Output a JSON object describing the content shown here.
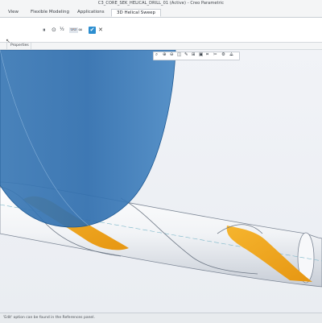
{
  "window": {
    "title": "C3_CORE_SEK_HELICAL_DRILL_01 (Active) - Creo Parametric"
  },
  "tabs": [
    {
      "label": "View"
    },
    {
      "label": "Flexible Modeling"
    },
    {
      "label": "Applications"
    },
    {
      "label": "3D Helical Sweep"
    }
  ],
  "ribbon": {
    "icons": [
      "pointer-arrow-icon",
      "pause-icon",
      "preview-icon",
      "verify-icon",
      "glasses-icon",
      "ok-icon",
      "cancel-icon"
    ],
    "pause_glyph": "⏸",
    "preview_glyph": "⊙",
    "verify_glyph": "½",
    "view_glyph": "∞",
    "ok_glyph": "✔",
    "cancel_glyph": "✕"
  },
  "subtabs": [
    {
      "label": "Properties"
    }
  ],
  "graphics_toolbar": {
    "icons": [
      "zoom-fit-icon",
      "zoom-in-icon",
      "zoom-out-icon",
      "repaint-icon",
      "reorient-icon",
      "saved-views-icon",
      "display-style-icon",
      "datum-display-icon",
      "annotation-icon",
      "spin-center-icon",
      "perspective-icon"
    ]
  },
  "status": {
    "message": "'Edit' option can be found in the References panel."
  },
  "colors": {
    "surface_blue": "#2f6eae",
    "flute_orange": "#f2a91e",
    "accent": "#2c8ed0"
  }
}
